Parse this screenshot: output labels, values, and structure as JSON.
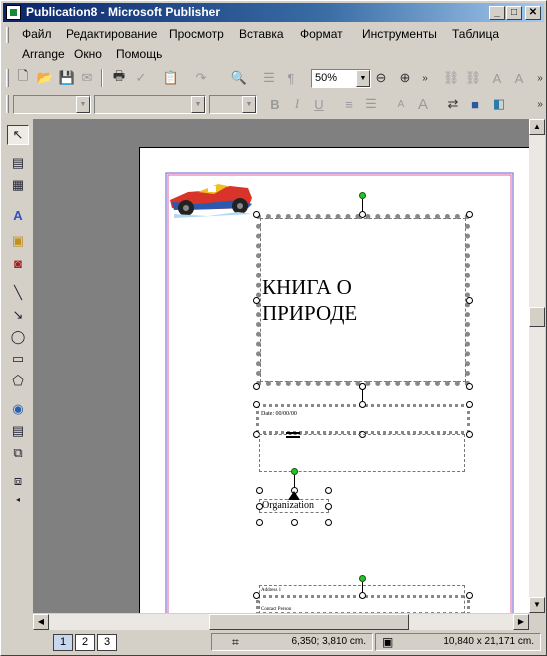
{
  "window": {
    "title": "Publication8 - Microsoft Publisher",
    "minimize": "_",
    "maximize": "□",
    "close": "✕"
  },
  "menu": {
    "items": [
      "Файл",
      "Редактирование",
      "Просмотр",
      "Вставка",
      "Формат",
      "Инструменты",
      "Таблица",
      "Arrange",
      "Окно",
      "Помощь"
    ]
  },
  "toolbar_standard": {
    "zoom_value": "50%"
  },
  "toolbar_formatting": {
    "style_value": "",
    "font_value": "",
    "size_value": ""
  },
  "document": {
    "heading_line1": "КНИГА О",
    "heading_line2": "ПРИРОДЕ",
    "date_text": "Date: 00/00/00",
    "org_text": "Organization",
    "lower_line1": "Address 1",
    "lower_line2": "Contact Person"
  },
  "status": {
    "pages": [
      "1",
      "2",
      "3"
    ],
    "current_page": "1",
    "position": "6,350; 3,810 cm.",
    "size": "10,840 x  21,171 cm."
  },
  "icons": {
    "title": "publisher-icon",
    "car": "race-car-clipart"
  },
  "colors": {
    "title_start": "#0a246a",
    "title_end": "#a6caf0",
    "handle_green": "#2ac02a"
  }
}
